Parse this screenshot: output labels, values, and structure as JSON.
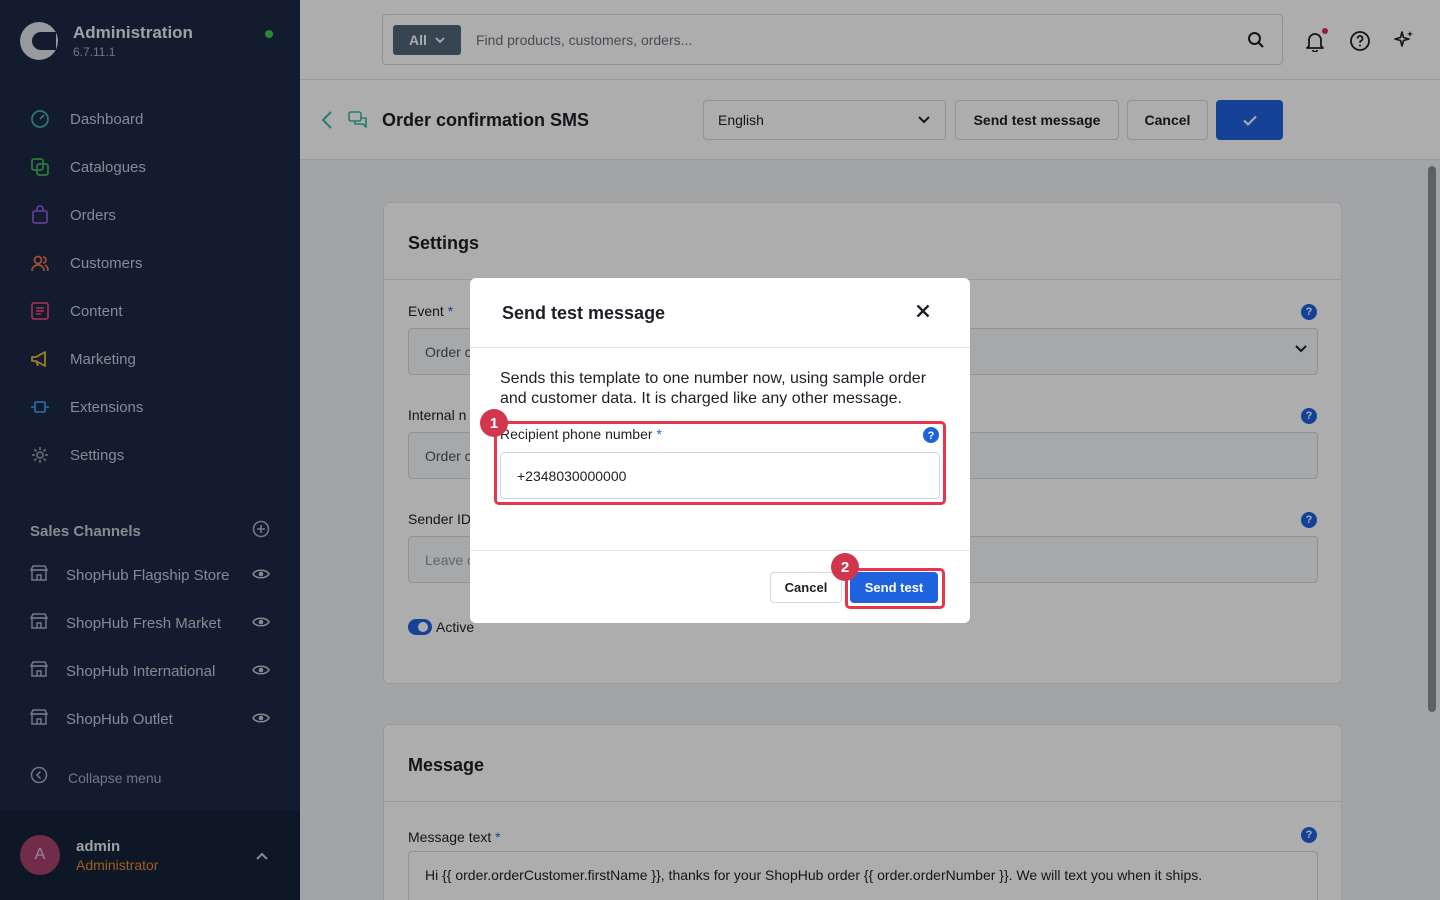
{
  "brand": {
    "title": "Administration",
    "version": "6.7.11.1"
  },
  "nav": {
    "items": [
      {
        "label": "Dashboard",
        "icon": "dashboard-icon",
        "color": "#3cb6a0"
      },
      {
        "label": "Catalogues",
        "icon": "catalogues-icon",
        "color": "#43b458"
      },
      {
        "label": "Orders",
        "icon": "orders-icon",
        "color": "#8a5bd6"
      },
      {
        "label": "Customers",
        "icon": "customers-icon",
        "color": "#e8774a"
      },
      {
        "label": "Content",
        "icon": "content-icon",
        "color": "#e0457b"
      },
      {
        "label": "Marketing",
        "icon": "marketing-icon",
        "color": "#e8b83a"
      },
      {
        "label": "Extensions",
        "icon": "extensions-icon",
        "color": "#3a95e8"
      },
      {
        "label": "Settings",
        "icon": "settings-icon",
        "color": "#8b95a3"
      }
    ]
  },
  "sales_channels": {
    "title": "Sales Channels",
    "items": [
      {
        "label": "ShopHub Flagship Store"
      },
      {
        "label": "ShopHub Fresh Market"
      },
      {
        "label": "ShopHub International"
      },
      {
        "label": "ShopHub Outlet"
      }
    ]
  },
  "collapse_label": "Collapse menu",
  "user": {
    "initial": "A",
    "name": "admin",
    "role": "Administrator"
  },
  "search": {
    "scope": "All",
    "placeholder": "Find products, customers, orders..."
  },
  "header": {
    "title": "Order confirmation SMS",
    "language": "English",
    "send_test_label": "Send test message",
    "cancel_label": "Cancel"
  },
  "settings_card": {
    "title": "Settings",
    "event_label": "Event",
    "event_value": "Order c",
    "internal_label": "Internal n",
    "internal_value": "Order c",
    "sender_label": "Sender ID",
    "sender_value": "Leave c",
    "active_label": "Active"
  },
  "message_card": {
    "title": "Message",
    "text_label": "Message text",
    "text_value": "Hi {{ order.orderCustomer.firstName }}, thanks for your ShopHub order {{ order.orderNumber }}. We will text you when it ships."
  },
  "modal": {
    "title": "Send test message",
    "description": "Sends this template to one number now, using sample order and customer data. It is charged like any other message.",
    "phone_label": "Recipient phone number",
    "phone_value": "+2348030000000",
    "cancel_label": "Cancel",
    "send_label": "Send test"
  },
  "markers": {
    "first": "1",
    "second": "2"
  },
  "colors": {
    "accent": "#1f62de",
    "sidebar": "#1b2a45",
    "marker": "#e4364f"
  }
}
